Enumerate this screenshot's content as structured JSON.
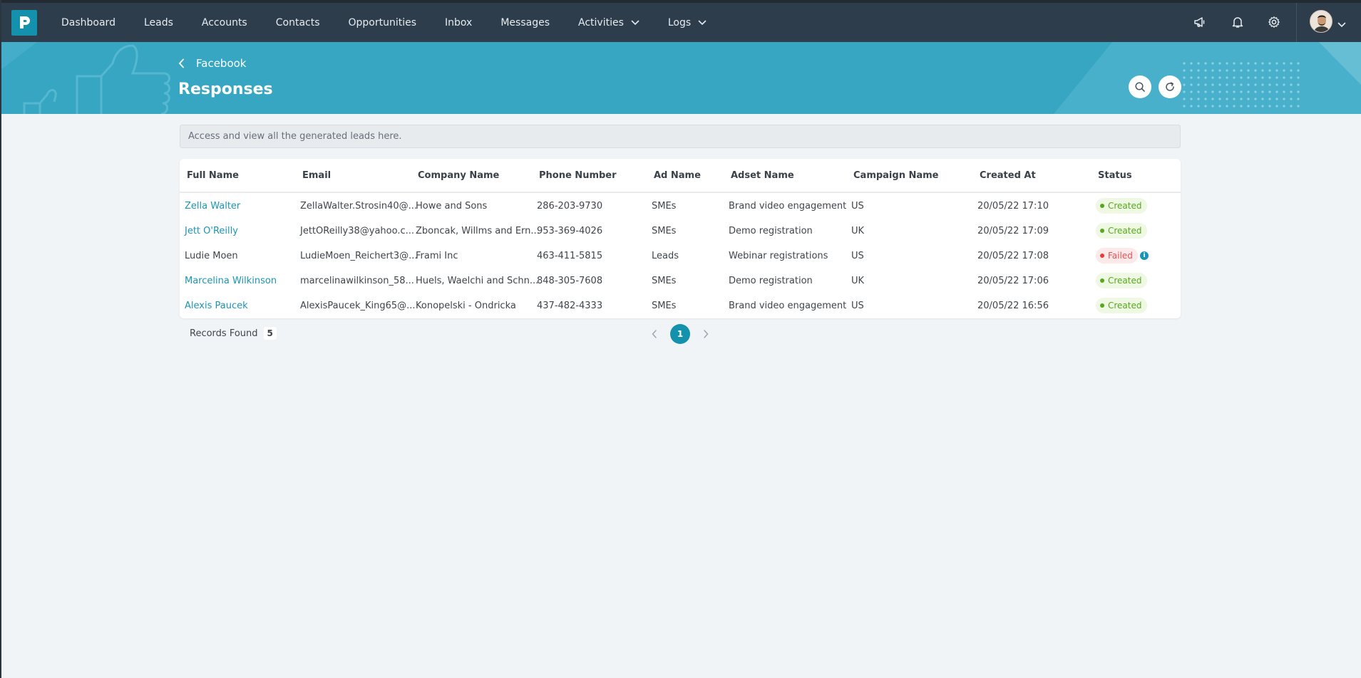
{
  "nav": {
    "items": [
      {
        "label": "Dashboard"
      },
      {
        "label": "Leads"
      },
      {
        "label": "Accounts"
      },
      {
        "label": "Contacts"
      },
      {
        "label": "Opportunities"
      },
      {
        "label": "Inbox"
      },
      {
        "label": "Messages"
      },
      {
        "label": "Activities",
        "dropdown": true
      },
      {
        "label": "Logs",
        "dropdown": true
      }
    ],
    "icons": [
      "megaphone-icon",
      "bell-icon",
      "gear-icon"
    ]
  },
  "header": {
    "back_label": "Facebook",
    "title": "Responses"
  },
  "info_text": "Access and view all the generated leads here.",
  "table": {
    "columns": [
      "Full Name",
      "Email",
      "Company Name",
      "Phone Number",
      "Ad Name",
      "Adset Name",
      "Campaign Name",
      "Created At",
      "Status"
    ],
    "rows": [
      {
        "full_name": "Zella Walter",
        "email": "ZellaWalter.Strosin40@...",
        "company": "Howe and Sons",
        "phone": "286-203-9730",
        "ad": "SMEs",
        "adset": "Brand video engagement",
        "campaign": "US",
        "created": "20/05/22 17:10",
        "status": "Created"
      },
      {
        "full_name": "Jett O'Reilly",
        "email": "JettOReilly38@yahoo.c...",
        "company": "Zboncak, Willms and Ern...",
        "phone": "953-369-4026",
        "ad": "SMEs",
        "adset": "Demo registration",
        "campaign": "UK",
        "created": "20/05/22 17:09",
        "status": "Created"
      },
      {
        "full_name": "Ludie Moen",
        "email": "LudieMoen_Reichert3@...",
        "company": "Frami Inc",
        "phone": "463-411-5815",
        "ad": "Leads",
        "adset": "Webinar registrations",
        "campaign": "US",
        "created": "20/05/22 17:08",
        "status": "Failed"
      },
      {
        "full_name": "Marcelina Wilkinson",
        "email": "marcelinawilkinson_58...",
        "company": "Huels, Waelchi and Schn...",
        "phone": "848-305-7608",
        "ad": "SMEs",
        "adset": "Demo registration",
        "campaign": "UK",
        "created": "20/05/22 17:06",
        "status": "Created"
      },
      {
        "full_name": "Alexis Paucek",
        "email": "AlexisPaucek_King65@...",
        "company": "Konopelski - Ondricka",
        "phone": "437-482-4333",
        "ad": "SMEs",
        "adset": "Brand video engagement",
        "campaign": "US",
        "created": "20/05/22 16:56",
        "status": "Created"
      }
    ]
  },
  "footer": {
    "records_label": "Records Found",
    "records_count": "5",
    "current_page": "1"
  },
  "colors": {
    "navbar": "#2e3d4b",
    "banner": "#36a6c3",
    "accent": "#1391ad",
    "link": "#1c95b5",
    "created": "#57a81e",
    "failed": "#e25353"
  }
}
